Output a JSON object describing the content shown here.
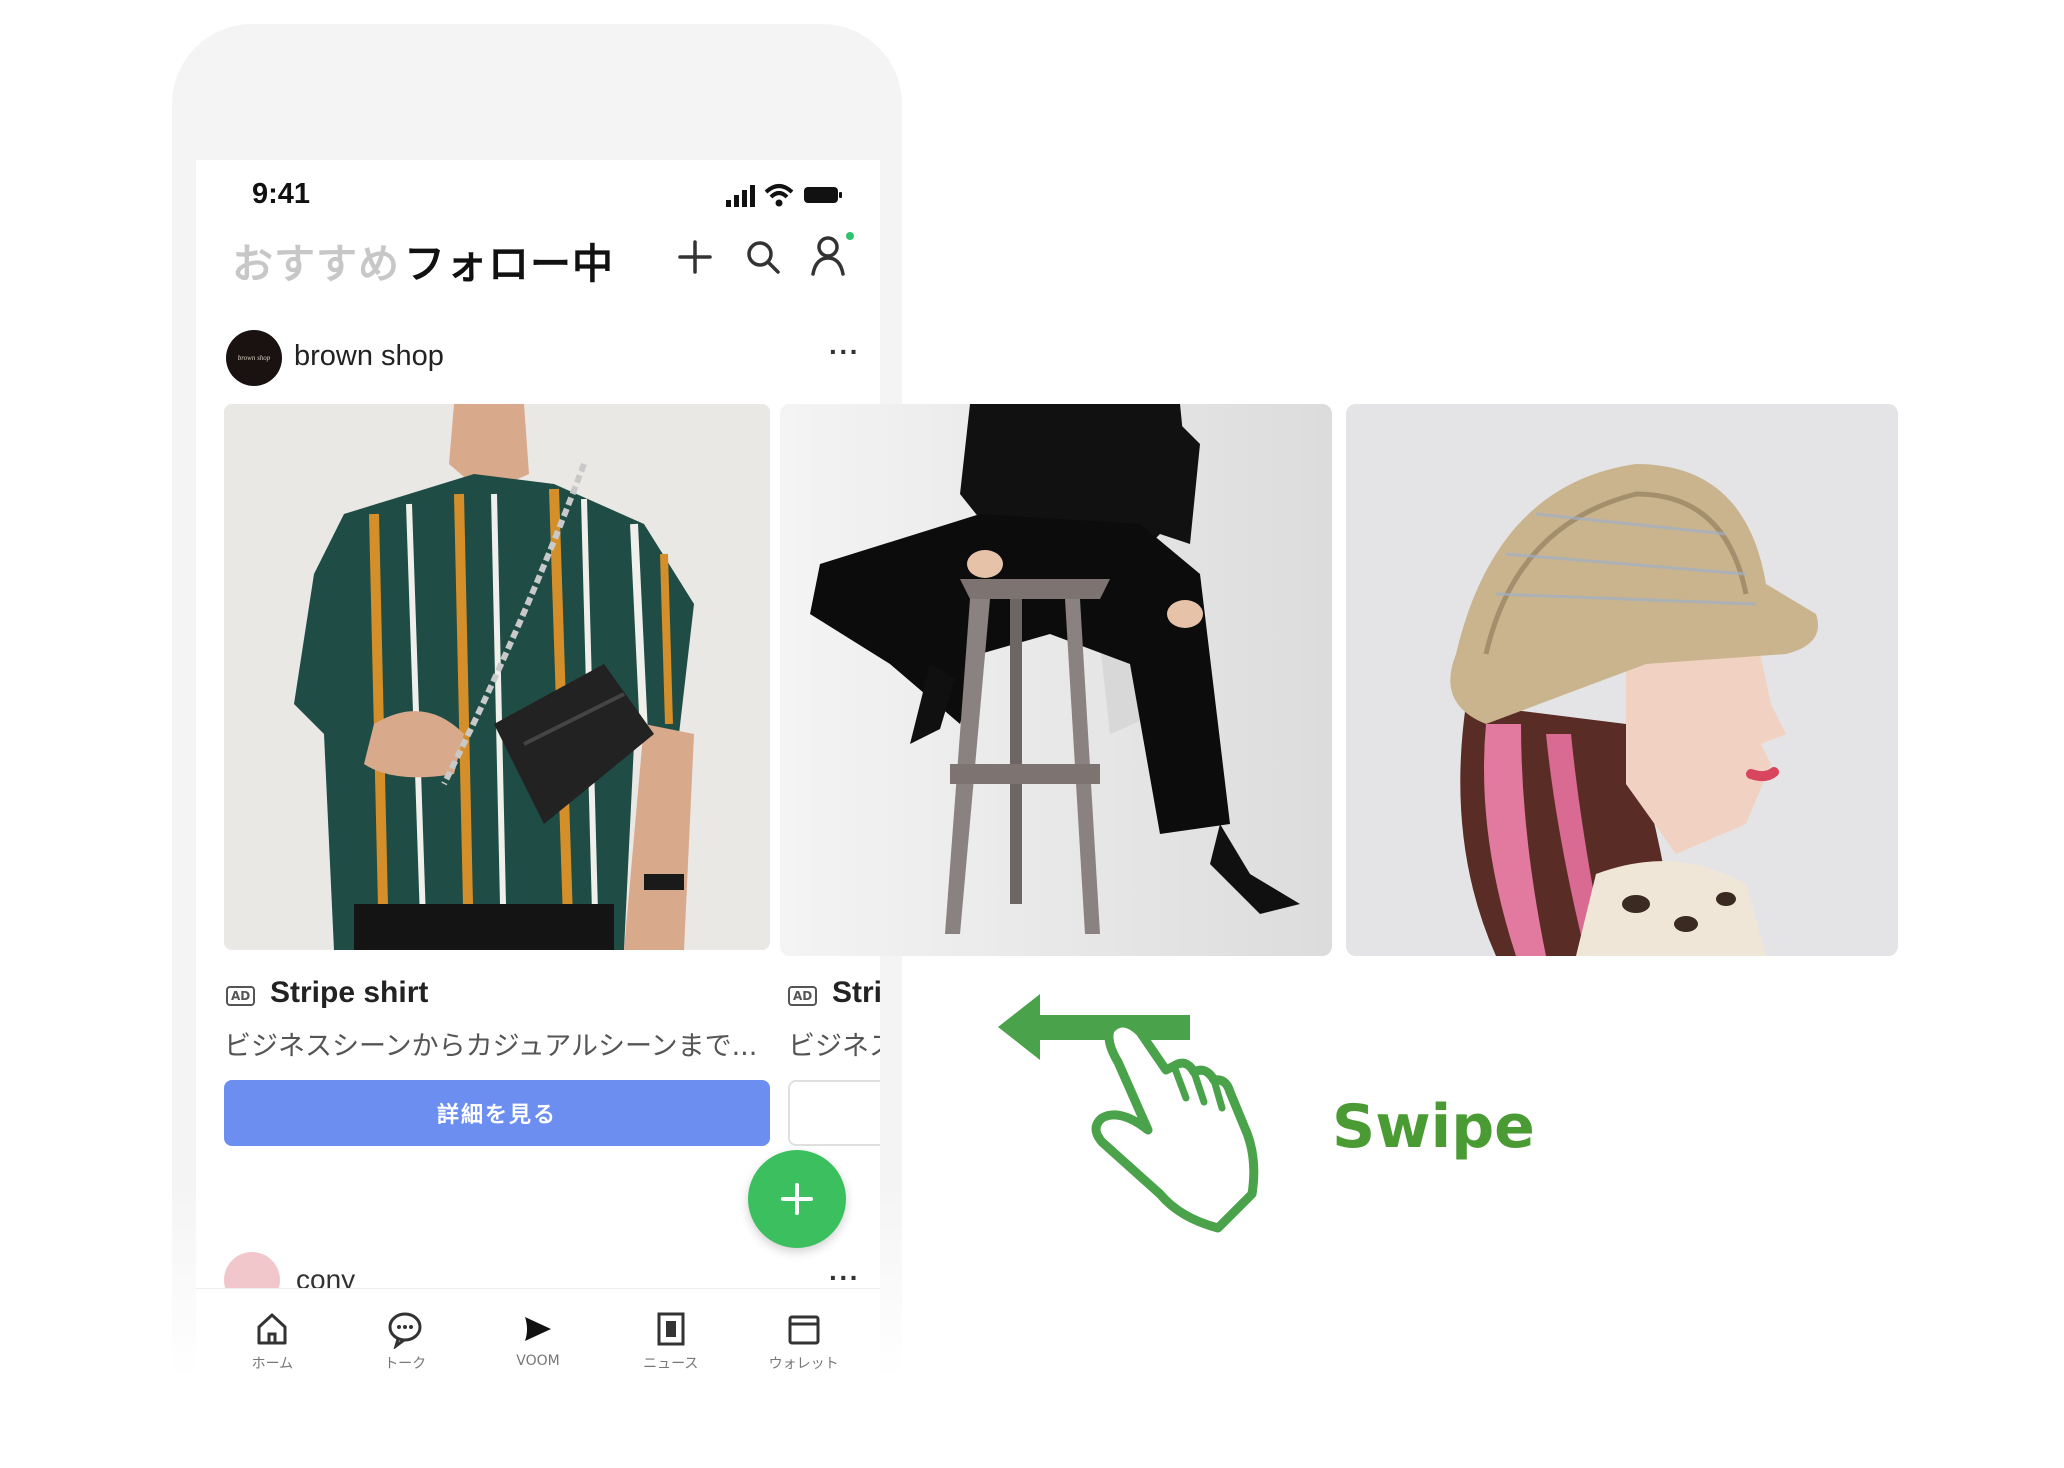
{
  "status_bar": {
    "time": "9:41"
  },
  "header": {
    "tab_recommend": "おすすめ",
    "tab_following": "フォロー中",
    "icons": [
      "plus-icon",
      "search-icon",
      "profile-icon"
    ]
  },
  "post": {
    "shop_name": "brown shop",
    "avatar_text": "brown shop",
    "more": "···",
    "cards": [
      {
        "badge": "AD",
        "title": "Stripe shirt",
        "description": "ビジネスシーンからカジュアルシーンまで...",
        "button_label": "詳細を見る",
        "image": "man-in-striped-shirt-photo"
      },
      {
        "badge": "AD",
        "title": "Stri",
        "description": "ビジネス",
        "image": "woman-sitting-on-stool-photo"
      },
      {
        "image": "woman-in-bucket-hat-photo"
      }
    ]
  },
  "post2": {
    "user_name": "cony",
    "more": "···"
  },
  "fab": {
    "icon": "plus-icon"
  },
  "bottom_nav": [
    {
      "label": "ホーム",
      "icon": "home-icon"
    },
    {
      "label": "トーク",
      "icon": "chat-icon"
    },
    {
      "label": "VOOM",
      "icon": "voom-icon"
    },
    {
      "label": "ニュース",
      "icon": "news-icon"
    },
    {
      "label": "ウォレット",
      "icon": "wallet-icon"
    }
  ],
  "gesture": {
    "label": "Swipe",
    "icon": "swipe-hand-icon"
  },
  "colors": {
    "accent_green": "#3cbf5e",
    "button_blue": "#6b8ef0",
    "swipe_green": "#4b9b34"
  }
}
